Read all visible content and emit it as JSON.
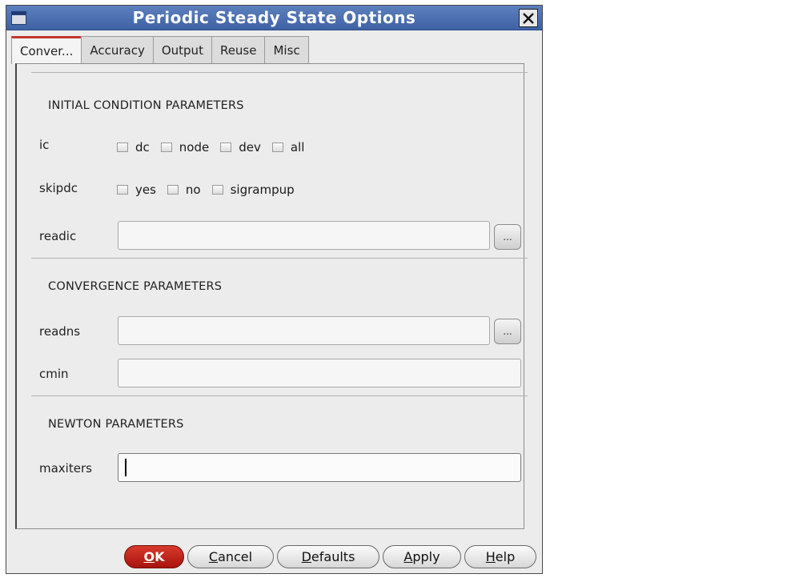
{
  "window": {
    "title": "Periodic Steady State Options"
  },
  "tabs": [
    {
      "label": "Conver..."
    },
    {
      "label": "Accuracy"
    },
    {
      "label": "Output"
    },
    {
      "label": "Reuse"
    },
    {
      "label": "Misc"
    }
  ],
  "active_tab": "Conver...",
  "initial_condition": {
    "heading": "INITIAL CONDITION PARAMETERS",
    "ic": {
      "label": "ic",
      "options": [
        "dc",
        "node",
        "dev",
        "all"
      ]
    },
    "skipdc": {
      "label": "skipdc",
      "options": [
        "yes",
        "no",
        "sigrampup"
      ]
    },
    "readic": {
      "label": "readic",
      "value": "",
      "browse_label": "..."
    }
  },
  "convergence": {
    "heading": "CONVERGENCE PARAMETERS",
    "readns": {
      "label": "readns",
      "value": "",
      "browse_label": "..."
    },
    "cmin": {
      "label": "cmin",
      "value": ""
    }
  },
  "newton": {
    "heading": "NEWTON PARAMETERS",
    "maxiters": {
      "label": "maxiters",
      "value": ""
    }
  },
  "buttons": {
    "ok": {
      "mnemonic": "O",
      "rest": "K"
    },
    "cancel": {
      "mnemonic": "C",
      "rest": "ancel"
    },
    "defaults": {
      "mnemonic": "D",
      "rest": "efaults"
    },
    "apply": {
      "mnemonic": "A",
      "rest": "pply"
    },
    "help": {
      "mnemonic": "H",
      "rest": "elp"
    }
  },
  "colors": {
    "titlebar": "#4a6db0",
    "ok_button": "#c0241a",
    "active_tab_accent": "#c0392b"
  }
}
